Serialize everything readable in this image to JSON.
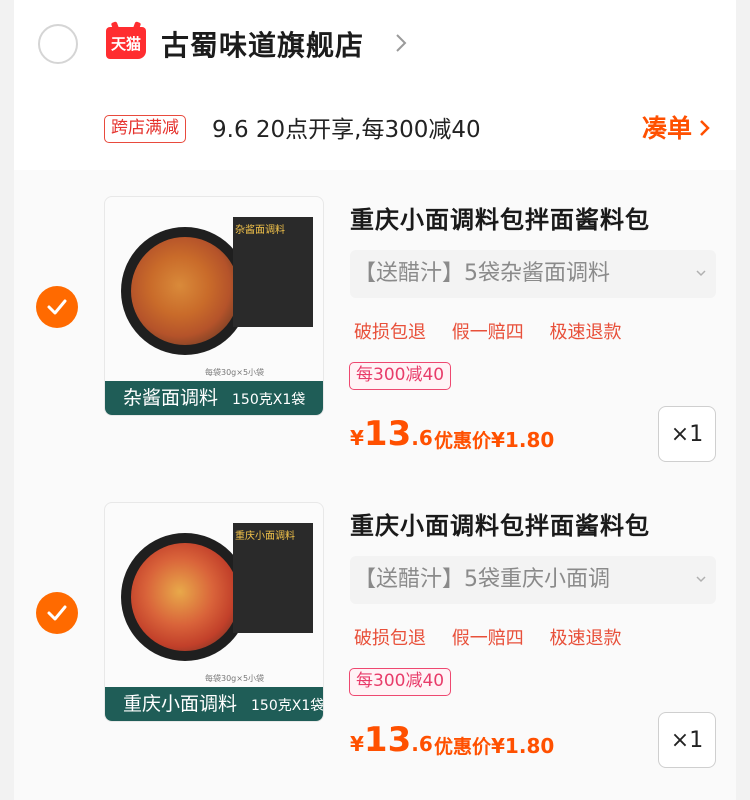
{
  "store": {
    "badge": "天猫",
    "name": "古蜀味道旗舰店",
    "promo_tag": "跨店满减",
    "promo_text": "9.6 20点开享,每300减40",
    "coudan_label": "凑单"
  },
  "items": [
    {
      "title": "重庆小面调料包拌面酱料包",
      "sku": "【送醋汁】5袋杂酱面调料",
      "services": [
        "破损包退",
        "假一赔四",
        "极速退款"
      ],
      "discount_tag": "每300减40",
      "price_symbol": "¥",
      "price_int": "13",
      "price_dec": ".6",
      "deal_label": "优惠价",
      "deal_price": "¥1.80",
      "qty": "×1",
      "thumb_label": "杂酱面调料",
      "thumb_spec": "150克X1袋",
      "thumb_box_title": "杂酱面调料",
      "thumb_caption": "每袋30g×5小袋"
    },
    {
      "title": "重庆小面调料包拌面酱料包",
      "sku": "【送醋汁】5袋重庆小面调",
      "services": [
        "破损包退",
        "假一赔四",
        "极速退款"
      ],
      "discount_tag": "每300减40",
      "price_symbol": "¥",
      "price_int": "13",
      "price_dec": ".6",
      "deal_label": "优惠价",
      "deal_price": "¥1.80",
      "qty": "×1",
      "thumb_label": "重庆小面调料",
      "thumb_spec": "150克X1袋",
      "thumb_box_title": "重庆小面调料",
      "thumb_caption": "每袋30g×5小袋"
    }
  ],
  "colors": {
    "accent": "#ff5000",
    "check": "#ff6a00",
    "tmall": "#ff2d30",
    "service": "#e8503a",
    "thumb_label_bg": "#1f5d57"
  }
}
